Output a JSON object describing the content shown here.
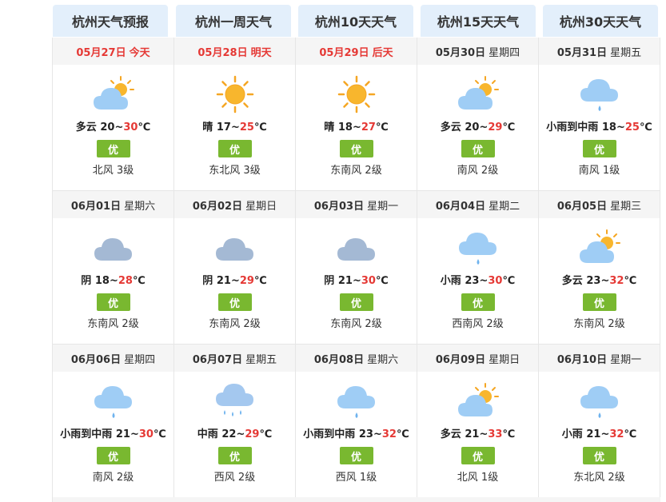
{
  "tabs": [
    "杭州天气预报",
    "杭州一周天气",
    "杭州10天天气",
    "杭州15天天气",
    "杭州30天天气"
  ],
  "colors": {
    "tab_bg": "#e3effb",
    "near_date": "#e53935",
    "aqi_good": "#79b830",
    "high_temp": "#e53935"
  },
  "days": [
    {
      "date": "05月27日",
      "weekday": "今天",
      "near": true,
      "icon": "partly-cloudy-icon",
      "cond": "多云",
      "low": "20",
      "high": "30",
      "aqi": "优",
      "wind": "北风 3级"
    },
    {
      "date": "05月28日",
      "weekday": "明天",
      "near": true,
      "icon": "sunny-icon",
      "cond": "晴",
      "low": "17",
      "high": "25",
      "aqi": "优",
      "wind": "东北风 3级"
    },
    {
      "date": "05月29日",
      "weekday": "后天",
      "near": true,
      "icon": "sunny-icon",
      "cond": "晴",
      "low": "18",
      "high": "27",
      "aqi": "优",
      "wind": "东南风 2级"
    },
    {
      "date": "05月30日",
      "weekday": "星期四",
      "near": false,
      "icon": "partly-cloudy-icon",
      "cond": "多云",
      "low": "20",
      "high": "29",
      "aqi": "优",
      "wind": "南风 2级"
    },
    {
      "date": "05月31日",
      "weekday": "星期五",
      "near": false,
      "icon": "light-rain-icon",
      "cond": "小雨到中雨",
      "low": "18",
      "high": "25",
      "aqi": "优",
      "wind": "南风 1级"
    },
    {
      "date": "06月01日",
      "weekday": "星期六",
      "near": false,
      "icon": "overcast-icon",
      "cond": "阴",
      "low": "18",
      "high": "28",
      "aqi": "优",
      "wind": "东南风 2级"
    },
    {
      "date": "06月02日",
      "weekday": "星期日",
      "near": false,
      "icon": "overcast-icon",
      "cond": "阴",
      "low": "21",
      "high": "29",
      "aqi": "优",
      "wind": "东南风 2级"
    },
    {
      "date": "06月03日",
      "weekday": "星期一",
      "near": false,
      "icon": "overcast-icon",
      "cond": "阴",
      "low": "21",
      "high": "30",
      "aqi": "优",
      "wind": "东南风 2级"
    },
    {
      "date": "06月04日",
      "weekday": "星期二",
      "near": false,
      "icon": "light-rain-icon",
      "cond": "小雨",
      "low": "23",
      "high": "30",
      "aqi": "优",
      "wind": "西南风 2级"
    },
    {
      "date": "06月05日",
      "weekday": "星期三",
      "near": false,
      "icon": "partly-cloudy-icon",
      "cond": "多云",
      "low": "23",
      "high": "32",
      "aqi": "优",
      "wind": "东南风 2级"
    },
    {
      "date": "06月06日",
      "weekday": "星期四",
      "near": false,
      "icon": "light-rain-icon",
      "cond": "小雨到中雨",
      "low": "21",
      "high": "30",
      "aqi": "优",
      "wind": "南风 2级"
    },
    {
      "date": "06月07日",
      "weekday": "星期五",
      "near": false,
      "icon": "moderate-rain-icon",
      "cond": "中雨",
      "low": "22",
      "high": "29",
      "aqi": "优",
      "wind": "西风 2级"
    },
    {
      "date": "06月08日",
      "weekday": "星期六",
      "near": false,
      "icon": "light-rain-icon",
      "cond": "小雨到中雨",
      "low": "23",
      "high": "32",
      "aqi": "优",
      "wind": "西风 1级"
    },
    {
      "date": "06月09日",
      "weekday": "星期日",
      "near": false,
      "icon": "partly-cloudy-icon",
      "cond": "多云",
      "low": "21",
      "high": "33",
      "aqi": "优",
      "wind": "北风 1级"
    },
    {
      "date": "06月10日",
      "weekday": "星期一",
      "near": false,
      "icon": "light-rain-icon",
      "cond": "小雨",
      "low": "21",
      "high": "32",
      "aqi": "优",
      "wind": "东北风 2级"
    }
  ]
}
